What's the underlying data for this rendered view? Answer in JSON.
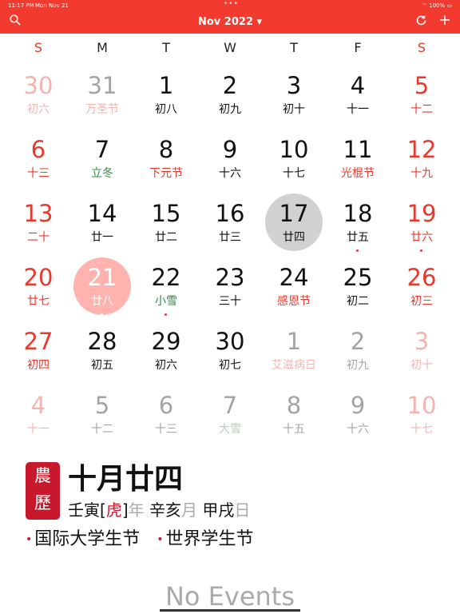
{
  "status_bar": {
    "time": "11:17 PM",
    "date": "Mon Nov 21",
    "battery": "100%"
  },
  "nav": {
    "title": "Nov 2022 ▾",
    "search_icon": "search-icon",
    "refresh_icon": "refresh-icon",
    "add_icon": "plus-icon"
  },
  "weekdays": [
    "S",
    "M",
    "T",
    "W",
    "T",
    "F",
    "S"
  ],
  "weeks": [
    [
      {
        "day": "30",
        "sub": "初六",
        "style": "dim red"
      },
      {
        "day": "31",
        "sub": "万圣节",
        "style": "dim",
        "sub_style": "redtxt"
      },
      {
        "day": "1",
        "sub": "初八",
        "style": ""
      },
      {
        "day": "2",
        "sub": "初九",
        "style": ""
      },
      {
        "day": "3",
        "sub": "初十",
        "style": ""
      },
      {
        "day": "4",
        "sub": "十一",
        "style": ""
      },
      {
        "day": "5",
        "sub": "十二",
        "style": "red"
      }
    ],
    [
      {
        "day": "6",
        "sub": "十三",
        "style": "red"
      },
      {
        "day": "7",
        "sub": "立冬",
        "style": "",
        "sub_style": "green"
      },
      {
        "day": "8",
        "sub": "下元节",
        "style": "",
        "sub_style": "redtxt"
      },
      {
        "day": "9",
        "sub": "十六",
        "style": ""
      },
      {
        "day": "10",
        "sub": "十七",
        "style": ""
      },
      {
        "day": "11",
        "sub": "光棍节",
        "style": "",
        "sub_style": "redtxt"
      },
      {
        "day": "12",
        "sub": "十九",
        "style": "red"
      }
    ],
    [
      {
        "day": "13",
        "sub": "二十",
        "style": "red"
      },
      {
        "day": "14",
        "sub": "廿一",
        "style": ""
      },
      {
        "day": "15",
        "sub": "廿二",
        "style": ""
      },
      {
        "day": "16",
        "sub": "廿三",
        "style": ""
      },
      {
        "day": "17",
        "sub": "廿四",
        "style": "today"
      },
      {
        "day": "18",
        "sub": "廿五",
        "style": "",
        "dot": true
      },
      {
        "day": "19",
        "sub": "廿六",
        "style": "red",
        "dot": true
      }
    ],
    [
      {
        "day": "20",
        "sub": "廿七",
        "style": "red"
      },
      {
        "day": "21",
        "sub": "廿八",
        "style": "selected",
        "dot": true
      },
      {
        "day": "22",
        "sub": "小雪",
        "style": "",
        "sub_style": "green",
        "dot": true
      },
      {
        "day": "23",
        "sub": "三十",
        "style": ""
      },
      {
        "day": "24",
        "sub": "感恩节",
        "style": "",
        "sub_style": "redtxt"
      },
      {
        "day": "25",
        "sub": "初二",
        "style": ""
      },
      {
        "day": "26",
        "sub": "初三",
        "style": "red"
      }
    ],
    [
      {
        "day": "27",
        "sub": "初四",
        "style": "red"
      },
      {
        "day": "28",
        "sub": "初五",
        "style": ""
      },
      {
        "day": "29",
        "sub": "初六",
        "style": ""
      },
      {
        "day": "30",
        "sub": "初七",
        "style": ""
      },
      {
        "day": "1",
        "sub": "艾滋病日",
        "style": "dim",
        "sub_style": "redtxt"
      },
      {
        "day": "2",
        "sub": "初九",
        "style": "dim"
      },
      {
        "day": "3",
        "sub": "初十",
        "style": "dim red"
      }
    ],
    [
      {
        "day": "4",
        "sub": "十一",
        "style": "dim red"
      },
      {
        "day": "5",
        "sub": "十二",
        "style": "dim"
      },
      {
        "day": "6",
        "sub": "十三",
        "style": "dim"
      },
      {
        "day": "7",
        "sub": "大雪",
        "style": "dim",
        "sub_style": "green"
      },
      {
        "day": "8",
        "sub": "十五",
        "style": "dim"
      },
      {
        "day": "9",
        "sub": "十六",
        "style": "dim"
      },
      {
        "day": "10",
        "sub": "十七",
        "style": "dim red"
      }
    ]
  ],
  "detail": {
    "seal_top": "農",
    "seal_bottom": "歷",
    "lunar_date": "十月廿四",
    "ganzhi": {
      "year_stem": "壬寅",
      "bracket_open": "[",
      "zodiac": "虎",
      "bracket_close": "]",
      "year_label": "年",
      "month_stem": "辛亥",
      "month_label": "月",
      "day_stem": "甲戌",
      "day_label": "日"
    },
    "festivals": [
      "国际大学生节",
      "世界学生节"
    ],
    "bullet": "•"
  },
  "events": {
    "empty_label": "No Events"
  },
  "colors": {
    "accent": "#f23a2e",
    "seal": "#c8182c",
    "green": "#2e8b3e",
    "today_circle": "#d1d1d1",
    "selected_circle": "#ffb3ae"
  }
}
